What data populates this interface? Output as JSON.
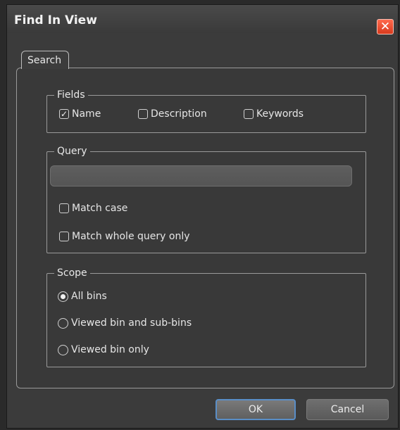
{
  "window": {
    "title": "Find In View"
  },
  "tabs": [
    {
      "label": "Search"
    }
  ],
  "fields": {
    "legend": "Fields",
    "options": [
      {
        "label": "Name",
        "checked": true
      },
      {
        "label": "Description",
        "checked": false
      },
      {
        "label": "Keywords",
        "checked": false
      }
    ]
  },
  "query": {
    "legend": "Query",
    "value": "",
    "options": [
      {
        "label": "Match case",
        "checked": false
      },
      {
        "label": "Match whole query only",
        "checked": false
      }
    ]
  },
  "scope": {
    "legend": "Scope",
    "options": [
      {
        "label": "All bins",
        "selected": true
      },
      {
        "label": "Viewed bin and sub-bins",
        "selected": false
      },
      {
        "label": "Viewed bin only",
        "selected": false
      }
    ]
  },
  "buttons": {
    "ok": "OK",
    "cancel": "Cancel"
  },
  "icons": {
    "close": "close-icon",
    "check": "check-icon"
  },
  "colors": {
    "close_button": "#e04a2c",
    "ok_focus_border": "#5a8ec7"
  }
}
